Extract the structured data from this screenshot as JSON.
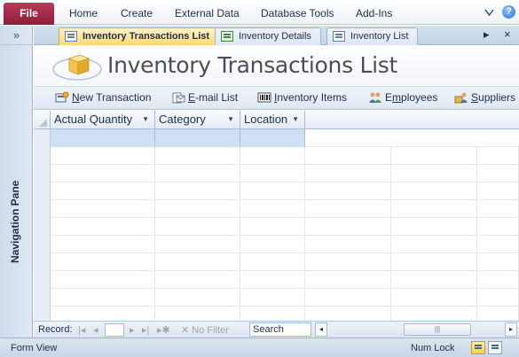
{
  "ribbon": {
    "file_label": "File",
    "tabs": [
      {
        "label": "Home"
      },
      {
        "label": "Create"
      },
      {
        "label": "External Data"
      },
      {
        "label": "Database Tools"
      },
      {
        "label": "Add-Ins"
      }
    ],
    "help_glyph": "?"
  },
  "nav_pane": {
    "toggle_glyph": "»",
    "label": "Navigation Pane"
  },
  "doc_tabs": [
    {
      "label": "Inventory Transactions List",
      "active": true
    },
    {
      "label": "Inventory Details",
      "active": false
    },
    {
      "label": "Inventory List",
      "active": false
    }
  ],
  "doc_tab_controls": {
    "scroll_glyph": "▸",
    "close_glyph": "×"
  },
  "form": {
    "title": "Inventory Transactions List"
  },
  "commands": {
    "new_transaction": {
      "accel": "N",
      "rest": "ew Transaction"
    },
    "email_list": {
      "accel": "E",
      "rest": "-mail List"
    },
    "inventory_items": {
      "accel": "I",
      "rest": "nventory Items"
    },
    "employees": {
      "pre": "E",
      "accel": "m",
      "rest": "ployees"
    },
    "suppliers": {
      "accel": "S",
      "rest": "uppliers"
    }
  },
  "datasheet": {
    "columns": [
      {
        "label": "Actual Quantity"
      },
      {
        "label": "Category"
      },
      {
        "label": "Location"
      }
    ],
    "rows": []
  },
  "record_nav": {
    "label": "Record:",
    "first": "|◂",
    "prev": "◂",
    "next": "▸",
    "last": "▸|",
    "new": "▸✱",
    "filter_label": "No Filter",
    "search_label": "Search",
    "scroll_left": "◂",
    "scroll_right": "▸",
    "thumb_grip": "|||"
  },
  "status_bar": {
    "view_label": "Form View",
    "num_lock": "Num Lock"
  },
  "colors": {
    "file_tab": "#a12b4b",
    "active_doc_tab": "#ffd87a",
    "new_row_highlight": "#cfe0f5"
  }
}
